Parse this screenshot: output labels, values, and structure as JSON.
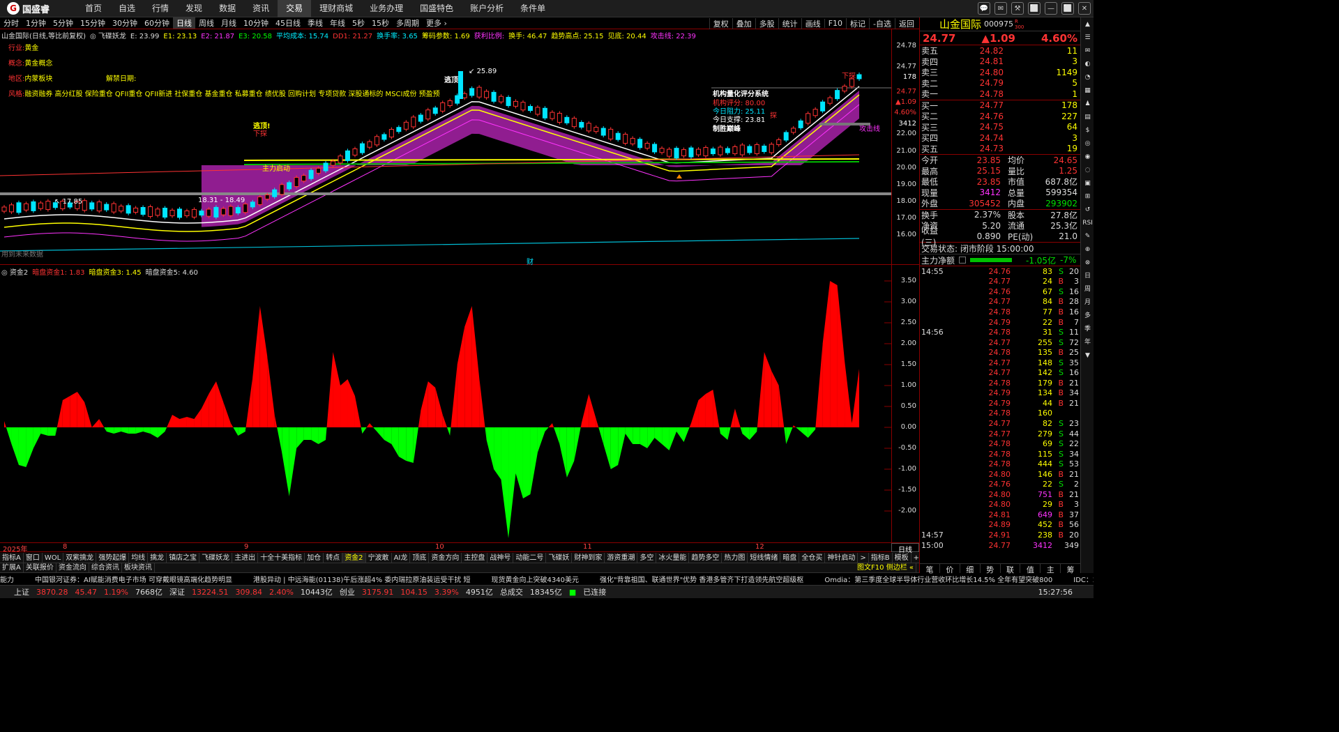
{
  "app": {
    "logo": "国盛睿",
    "nav": [
      "首页",
      "自选",
      "行情",
      "发现",
      "数据",
      "资讯",
      "交易",
      "理财商城",
      "业务办理",
      "国盛特色",
      "账户分析",
      "条件单"
    ],
    "active_nav": "交易",
    "window_controls": [
      "💬",
      "✉",
      "⚒",
      "⬜",
      "—",
      "⬜",
      "✕"
    ]
  },
  "periods": [
    "分时",
    "1分钟",
    "5分钟",
    "15分钟",
    "30分钟",
    "60分钟",
    "日线",
    "周线",
    "月线",
    "10分钟",
    "45日线",
    "季线",
    "年线",
    "5秒",
    "15秒",
    "多周期",
    "更多 ›"
  ],
  "active_period": "日线",
  "right_tools": [
    "复权",
    "叠加",
    "多股",
    "统计",
    "画线",
    "F10",
    "标记",
    "-自选",
    "返回"
  ],
  "main": {
    "info": [
      {
        "t": "山金国际(日线,等比前复权)",
        "c": "#ddd"
      },
      {
        "t": "◎ 飞碟妖龙",
        "c": "#ddd"
      },
      {
        "t": "E: 23.99",
        "c": "#ddd"
      },
      {
        "t": "E1: 23.13",
        "c": "#ff0"
      },
      {
        "t": "E2: 21.87",
        "c": "#f3f"
      },
      {
        "t": "E3: 20.58",
        "c": "#0f0"
      },
      {
        "t": "平均成本: 15.74",
        "c": "#0ef"
      },
      {
        "t": "DD1: 21.27",
        "c": "#f33"
      },
      {
        "t": "换手率: 3.65",
        "c": "#0ef"
      },
      {
        "t": "筹码参数: 1.69",
        "c": "#ff0"
      },
      {
        "t": "获利比例:",
        "c": "#f3f"
      },
      {
        "t": "换手: 46.47",
        "c": "#ff0"
      },
      {
        "t": "趋势高点: 25.15",
        "c": "#ff0"
      },
      {
        "t": "见底: 20.44",
        "c": "#ff0"
      },
      {
        "t": "攻击线: 22.39",
        "c": "#f3f"
      }
    ],
    "left_labels": [
      {
        "k": "行业:",
        "v": "黄金",
        "y": 18
      },
      {
        "k": "概念:",
        "v": "黄金概念",
        "y": 40
      },
      {
        "k": "地区:",
        "v": "内蒙板块",
        "y": 62
      },
      {
        "k": "风格:",
        "v": "融资融券 高分红股 保险重仓 QFII重仓 QFII新进 社保重仓 基金重仓 私募重仓 绩优股 回购计划 专项贷款 深股通标的 MSCI成份 预盈预",
        "y": 84
      }
    ],
    "lift_date": "解禁日期:",
    "inst": {
      "title": "机构量化评分系统",
      "score": "机构评分: 80.00",
      "res": "今日阻力: 25.11",
      "sup": "今日支撑: 23.81",
      "tag": "制胜巅峰"
    },
    "annotations": {
      "high": "25.89",
      "low": "17.85",
      "range": "18.31 - 18.49",
      "escape1": "逃顶!",
      "escape2": "逃顶",
      "down1": "下探",
      "down2": "下探",
      "zlqd": "主力启动",
      "attack": "攻击线",
      "cai": "财",
      "no_data": "用到未来数据",
      "probe": "探"
    },
    "yticks": [
      "24.78",
      "24.77",
      "178",
      "24.77",
      "▲1.09",
      "4.60%",
      "3412",
      "22.00",
      "21.00",
      "20.00",
      "19.00",
      "18.00",
      "17.00",
      "16.00"
    ]
  },
  "sub": {
    "info": [
      {
        "t": "◎ 资金2",
        "c": "#ddd"
      },
      {
        "t": "暗盘资金1: 1.83",
        "c": "#f33"
      },
      {
        "t": "暗盘资金3: 1.45",
        "c": "#ff0"
      },
      {
        "t": "暗盘资金5: 4.60",
        "c": "#ddd"
      }
    ],
    "yticks": [
      "3.50",
      "3.00",
      "2.50",
      "2.00",
      "1.50",
      "1.00",
      "0.50",
      "0.00",
      "-0.50",
      "-1.00",
      "-1.50",
      "-2.00"
    ]
  },
  "chart_data": {
    "type": "area",
    "title": "暗盘资金",
    "ylim": [
      -2.6,
      3.7
    ],
    "values": [
      0.15,
      -0.4,
      -0.9,
      -0.95,
      -0.5,
      -0.15,
      -0.2,
      -0.2,
      0.65,
      0.75,
      0.85,
      0.6,
      0.0,
      0.2,
      -0.1,
      -0.15,
      -0.1,
      -0.15,
      -0.15,
      -0.1,
      -0.15,
      -0.25,
      -0.1,
      0.3,
      0.2,
      0.25,
      0.2,
      0.45,
      0.8,
      1.1,
      0.6,
      0.1,
      -0.2,
      -0.1,
      1.2,
      2.9,
      1.7,
      0.3,
      -0.6,
      -1.65,
      -0.5,
      -0.3,
      -0.3,
      -0.4,
      -0.3,
      1.8,
      1.0,
      1.15,
      0.75,
      -0.15,
      0.1,
      -0.1,
      -0.3,
      -0.4,
      -0.7,
      -0.8,
      -0.85,
      0.4,
      1.1,
      0.95,
      0.3,
      -0.2,
      1.5,
      2.4,
      2.9,
      1.2,
      -0.3,
      -1.0,
      -1.25,
      -2.65,
      -1.1,
      -1.7,
      -1.6,
      -0.6,
      -0.1,
      0.1,
      -0.4,
      -1.2,
      -0.8,
      0.1,
      0.8,
      0.2,
      -0.4,
      -1.0,
      -0.9,
      -0.15,
      -0.4,
      -0.4,
      -0.5,
      -0.25,
      -0.4,
      -0.55,
      -0.1,
      -0.35,
      0.1,
      0.65,
      0.8,
      0.9,
      -0.15,
      -0.3,
      0.45,
      -0.15,
      -0.3,
      -0.1,
      1.8,
      1.35,
      1.0,
      -0.4,
      0.05,
      -0.1,
      -0.25,
      -0.05,
      2.0,
      3.5,
      3.4,
      1.6,
      0.1,
      1.4
    ]
  },
  "xaxis": {
    "labels": [
      "2025年",
      "8",
      "9",
      "10",
      "11",
      "12"
    ],
    "day": "日线"
  },
  "tabs1": [
    "指标A",
    "窗口",
    "WOL",
    "双紫擒龙",
    "强势起爆",
    "均线",
    "擒龙",
    "镇店之宝",
    "飞碟妖龙",
    "主进出",
    "十全十美指标",
    "加仓",
    "转点",
    "资金2",
    "宁波敢",
    "AI龙",
    "顶底",
    "资金方向",
    "主控盘",
    "战神号",
    "动能二号",
    "飞碟妖",
    "财神到家",
    "游资重潮",
    "多空",
    "冰火量能",
    "趋势多空",
    "热力图",
    "短线情绪",
    "暗盘",
    "全仓买",
    "神针启动",
    ">",
    "指标B",
    "模板",
    "+",
    "-"
  ],
  "tabs1_active": "资金2",
  "tabs2": [
    "扩展A",
    "关联报价",
    "资金流向",
    "综合资讯",
    "板块资讯"
  ],
  "tabs2_right": "图文F10 侧边栏 «",
  "news": [
    "能力",
    "中国银河证券：AI赋能消费电子市场 可穿戴眼镜高端化趋势明显",
    "港股异动 | 中远海能(01138)午后涨超4% 委内瑞拉原油装运受干扰 短",
    "现货黄金向上突破4340美元",
    "强化\"背靠祖国、联通世界\"优势 香港多管齐下打造领先航空超级枢",
    "Omdia：第三季度全球半导体行业营收环比增长14.5% 全年有望突破800",
    "IDC：2"
  ],
  "status": {
    "sh_label": "上证",
    "sh": "3870.28",
    "sh_chg": "45.47",
    "sh_pct": "1.19%",
    "sh_amt": "7668亿",
    "sz_label": "深证",
    "sz": "13224.51",
    "sz_chg": "309.84",
    "sz_pct": "2.40%",
    "sz_amt": "10443亿",
    "cy_label": "创业",
    "cy": "3175.91",
    "cy_chg": "104.15",
    "cy_pct": "3.39%",
    "cy_amt": "4951亿",
    "total_label": "总成交",
    "total": "18345亿",
    "conn": "已连接",
    "time": "15:27:56"
  },
  "quote": {
    "name": "山金国际",
    "code": "000975",
    "code_sub": "R 300",
    "price": "24.77",
    "chg": "▲1.09",
    "pct": "4.60%",
    "asks": [
      [
        "卖五",
        "24.82",
        "11"
      ],
      [
        "卖四",
        "24.81",
        "3"
      ],
      [
        "卖三",
        "24.80",
        "1149"
      ],
      [
        "卖二",
        "24.79",
        "5"
      ],
      [
        "卖一",
        "24.78",
        "1"
      ]
    ],
    "bids": [
      [
        "买一",
        "24.77",
        "178"
      ],
      [
        "买二",
        "24.76",
        "227"
      ],
      [
        "买三",
        "24.75",
        "64"
      ],
      [
        "买四",
        "24.74",
        "3"
      ],
      [
        "买五",
        "24.73",
        "19"
      ]
    ],
    "stats": [
      [
        "今开",
        "23.85",
        "red",
        "均价",
        "24.65",
        "red"
      ],
      [
        "最高",
        "25.15",
        "red",
        "量比",
        "1.25",
        "red"
      ],
      [
        "最低",
        "23.85",
        "red",
        "市值",
        "687.8亿",
        "white"
      ],
      [
        "现量",
        "3412",
        "mag",
        "总量",
        "599354",
        "white"
      ],
      [
        "外盘",
        "305452",
        "red",
        "内盘",
        "293902",
        "green"
      ]
    ],
    "stats2": [
      [
        "换手",
        "2.37%",
        "white",
        "股本",
        "27.8亿",
        "white"
      ],
      [
        "净资",
        "5.20",
        "white",
        "流通",
        "25.3亿",
        "white"
      ],
      [
        "收益(三)",
        "0.890",
        "white",
        "PE(动)",
        "21.0",
        "white"
      ]
    ],
    "trade_state": "交易状态: 闭市阶段 15:00:00",
    "mainflow_label": "主力净额",
    "mainflow_val": "-1.05亿",
    "mainflow_pct": "-7%",
    "ticks": [
      [
        "14:55",
        "24.76",
        "83",
        "S",
        "20"
      ],
      [
        "",
        "24.77",
        "24",
        "B",
        "3"
      ],
      [
        "",
        "24.76",
        "67",
        "S",
        "16"
      ],
      [
        "",
        "24.77",
        "84",
        "B",
        "28"
      ],
      [
        "",
        "24.78",
        "77",
        "B",
        "16"
      ],
      [
        "",
        "24.79",
        "22",
        "B",
        "7"
      ],
      [
        "14:56",
        "24.78",
        "31",
        "S",
        "11"
      ],
      [
        "",
        "24.77",
        "255",
        "S",
        "72"
      ],
      [
        "",
        "24.78",
        "135",
        "B",
        "25"
      ],
      [
        "",
        "24.77",
        "148",
        "S",
        "35"
      ],
      [
        "",
        "24.77",
        "142",
        "S",
        "16"
      ],
      [
        "",
        "24.78",
        "179",
        "B",
        "21"
      ],
      [
        "",
        "24.79",
        "134",
        "B",
        "34"
      ],
      [
        "",
        "24.79",
        "44",
        "B",
        "21"
      ],
      [
        "",
        "24.78",
        "160",
        "",
        ""
      ],
      [
        "",
        "24.77",
        "82",
        "S",
        "23"
      ],
      [
        "",
        "24.77",
        "279",
        "S",
        "44"
      ],
      [
        "",
        "24.78",
        "69",
        "S",
        "22"
      ],
      [
        "",
        "24.78",
        "115",
        "S",
        "34"
      ],
      [
        "",
        "24.78",
        "444",
        "S",
        "53"
      ],
      [
        "",
        "24.80",
        "146",
        "B",
        "21"
      ],
      [
        "",
        "24.76",
        "22",
        "S",
        "2"
      ],
      [
        "",
        "24.80",
        "751",
        "B",
        "21"
      ],
      [
        "",
        "24.80",
        "29",
        "B",
        "3"
      ],
      [
        "",
        "24.81",
        "649",
        "B",
        "37"
      ],
      [
        "",
        "24.89",
        "452",
        "B",
        "56"
      ],
      [
        "14:57",
        "24.91",
        "238",
        "B",
        "20"
      ],
      [
        "15:00",
        "24.77",
        "3412",
        "",
        "349"
      ]
    ],
    "bottom_tabs": [
      "笔",
      "价",
      "细",
      "势",
      "联",
      "值",
      "主",
      "筹"
    ]
  },
  "sidebar": [
    "▲",
    "☰",
    "✉",
    "◐",
    "◔",
    "▦",
    "♟",
    "▤",
    "$",
    "◎",
    "◉",
    "◌",
    "▣",
    "⊞",
    "↺",
    "RSI",
    "✎",
    "⊕",
    "⊗",
    "日",
    "周",
    "月",
    "多",
    "季",
    "年",
    "▼"
  ]
}
